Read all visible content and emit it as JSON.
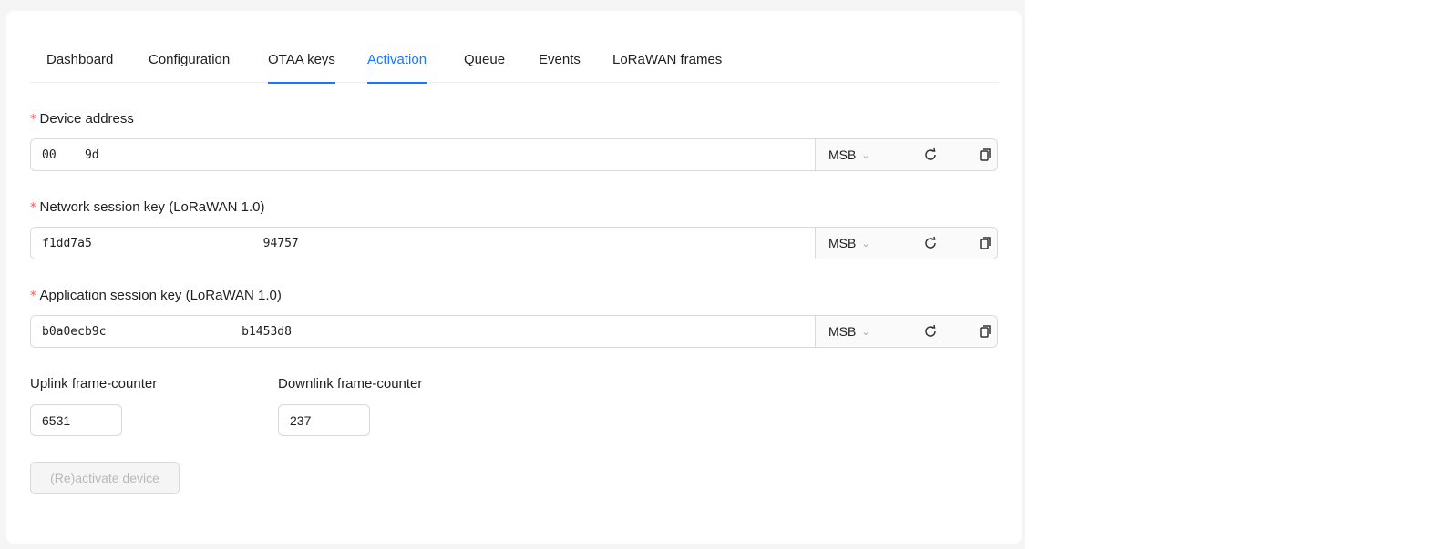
{
  "tabs": [
    {
      "label": "Dashboard",
      "active": false
    },
    {
      "label": "Configuration",
      "active": false
    },
    {
      "label": "OTAA keys",
      "active": false
    },
    {
      "label": "Activation",
      "active": true
    },
    {
      "label": "Queue",
      "active": false
    },
    {
      "label": "Events",
      "active": false
    },
    {
      "label": "LoRaWAN frames",
      "active": false
    }
  ],
  "required_marker": "*",
  "fields": {
    "dev_addr": {
      "label": "Device address",
      "value": "00    9d",
      "byte_order": "MSB"
    },
    "nwk_s_key": {
      "label": "Network session key (LoRaWAN 1.0)",
      "value": "f1dd7a5                        94757",
      "byte_order": "MSB"
    },
    "app_s_key": {
      "label": "Application session key (LoRaWAN 1.0)",
      "value": "b0a0ecb9c                   b1453d8",
      "byte_order": "MSB"
    }
  },
  "icons": {
    "chevron": "chevron-down-icon",
    "refresh": "refresh-icon",
    "copy": "copy-icon"
  },
  "uplink": {
    "label": "Uplink frame-counter",
    "value": "6531"
  },
  "downlink": {
    "label": "Downlink frame-counter",
    "value": "237"
  },
  "activate_button": {
    "label": "(Re)activate device",
    "disabled": true
  },
  "colors": {
    "accent": "#1677ff",
    "required": "#ff4d4f",
    "page_bg": "#f5f5f5"
  }
}
